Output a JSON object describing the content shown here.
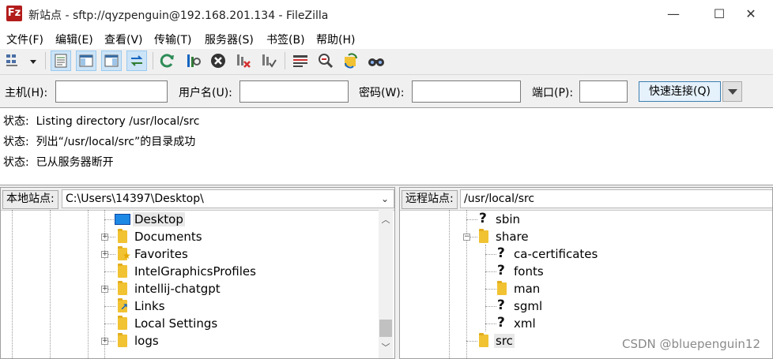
{
  "window": {
    "app_icon": "Fz",
    "title": "新站点 - sftp://qyzpenguin@192.168.201.134 - FileZilla",
    "controls": [
      "minimize-icon",
      "maximize-icon",
      "close-icon"
    ]
  },
  "menu": [
    "文件(F)",
    "编辑(E)",
    "查看(V)",
    "传输(T)",
    "服务器(S)",
    "书签(B)",
    "帮助(H)"
  ],
  "toolbar": {
    "icons": [
      "site-manager-icon",
      "dropdown-arrow-icon",
      "toggle-log-icon",
      "toggle-local-tree-icon",
      "toggle-remote-tree-icon",
      "toggle-queue-icon",
      "refresh-icon",
      "process-queue-icon",
      "cancel-icon",
      "disconnect-icon",
      "reconnect-icon",
      "directory-listing-filter-icon",
      "compare-icon",
      "sync-browse-icon",
      "search-icon"
    ]
  },
  "quickconnect": {
    "host_label": "主机(H):",
    "host_value": "",
    "user_label": "用户名(U):",
    "user_value": "",
    "pass_label": "密码(W):",
    "pass_value": "",
    "port_label": "端口(P):",
    "port_value": "",
    "connect_button": "快速连接(Q)"
  },
  "log": [
    {
      "prefix": "状态:",
      "text": "Listing directory /usr/local/src"
    },
    {
      "prefix": "状态:",
      "text": "列出“/usr/local/src”的目录成功"
    },
    {
      "prefix": "状态:",
      "text": "已从服务器断开"
    }
  ],
  "local": {
    "label": "本地站点:",
    "path": "C:\\Users\\14397\\Desktop\\",
    "tree": [
      {
        "name": "Desktop",
        "icon": "desktop-icon",
        "selected": true
      },
      {
        "name": "Documents",
        "icon": "folder-icon",
        "expandable": true
      },
      {
        "name": "Favorites",
        "icon": "favorites-folder-icon",
        "expandable": true
      },
      {
        "name": "IntelGraphicsProfiles",
        "icon": "folder-icon"
      },
      {
        "name": "intellij-chatgpt",
        "icon": "folder-icon",
        "expandable": true
      },
      {
        "name": "Links",
        "icon": "links-folder-icon"
      },
      {
        "name": "Local Settings",
        "icon": "folder-icon"
      },
      {
        "name": "logs",
        "icon": "folder-icon",
        "expandable": true
      }
    ]
  },
  "remote": {
    "label": "远程站点:",
    "path": "/usr/local/src",
    "tree": [
      {
        "name": "sbin",
        "icon": "unknown-folder-icon",
        "level": 0
      },
      {
        "name": "share",
        "icon": "folder-icon",
        "level": 0,
        "expanded": true
      },
      {
        "name": "ca-certificates",
        "icon": "unknown-folder-icon",
        "level": 1
      },
      {
        "name": "fonts",
        "icon": "unknown-folder-icon",
        "level": 1
      },
      {
        "name": "man",
        "icon": "folder-icon",
        "level": 1
      },
      {
        "name": "sgml",
        "icon": "unknown-folder-icon",
        "level": 1
      },
      {
        "name": "xml",
        "icon": "unknown-folder-icon",
        "level": 1
      },
      {
        "name": "src",
        "icon": "folder-icon",
        "level": 0,
        "selected": true
      }
    ]
  },
  "watermark": "CSDN @bluepenguin12",
  "colors": {
    "accent": "#cce4f7",
    "folder": "#f1c232",
    "connect_button": "#e5f1fb"
  }
}
